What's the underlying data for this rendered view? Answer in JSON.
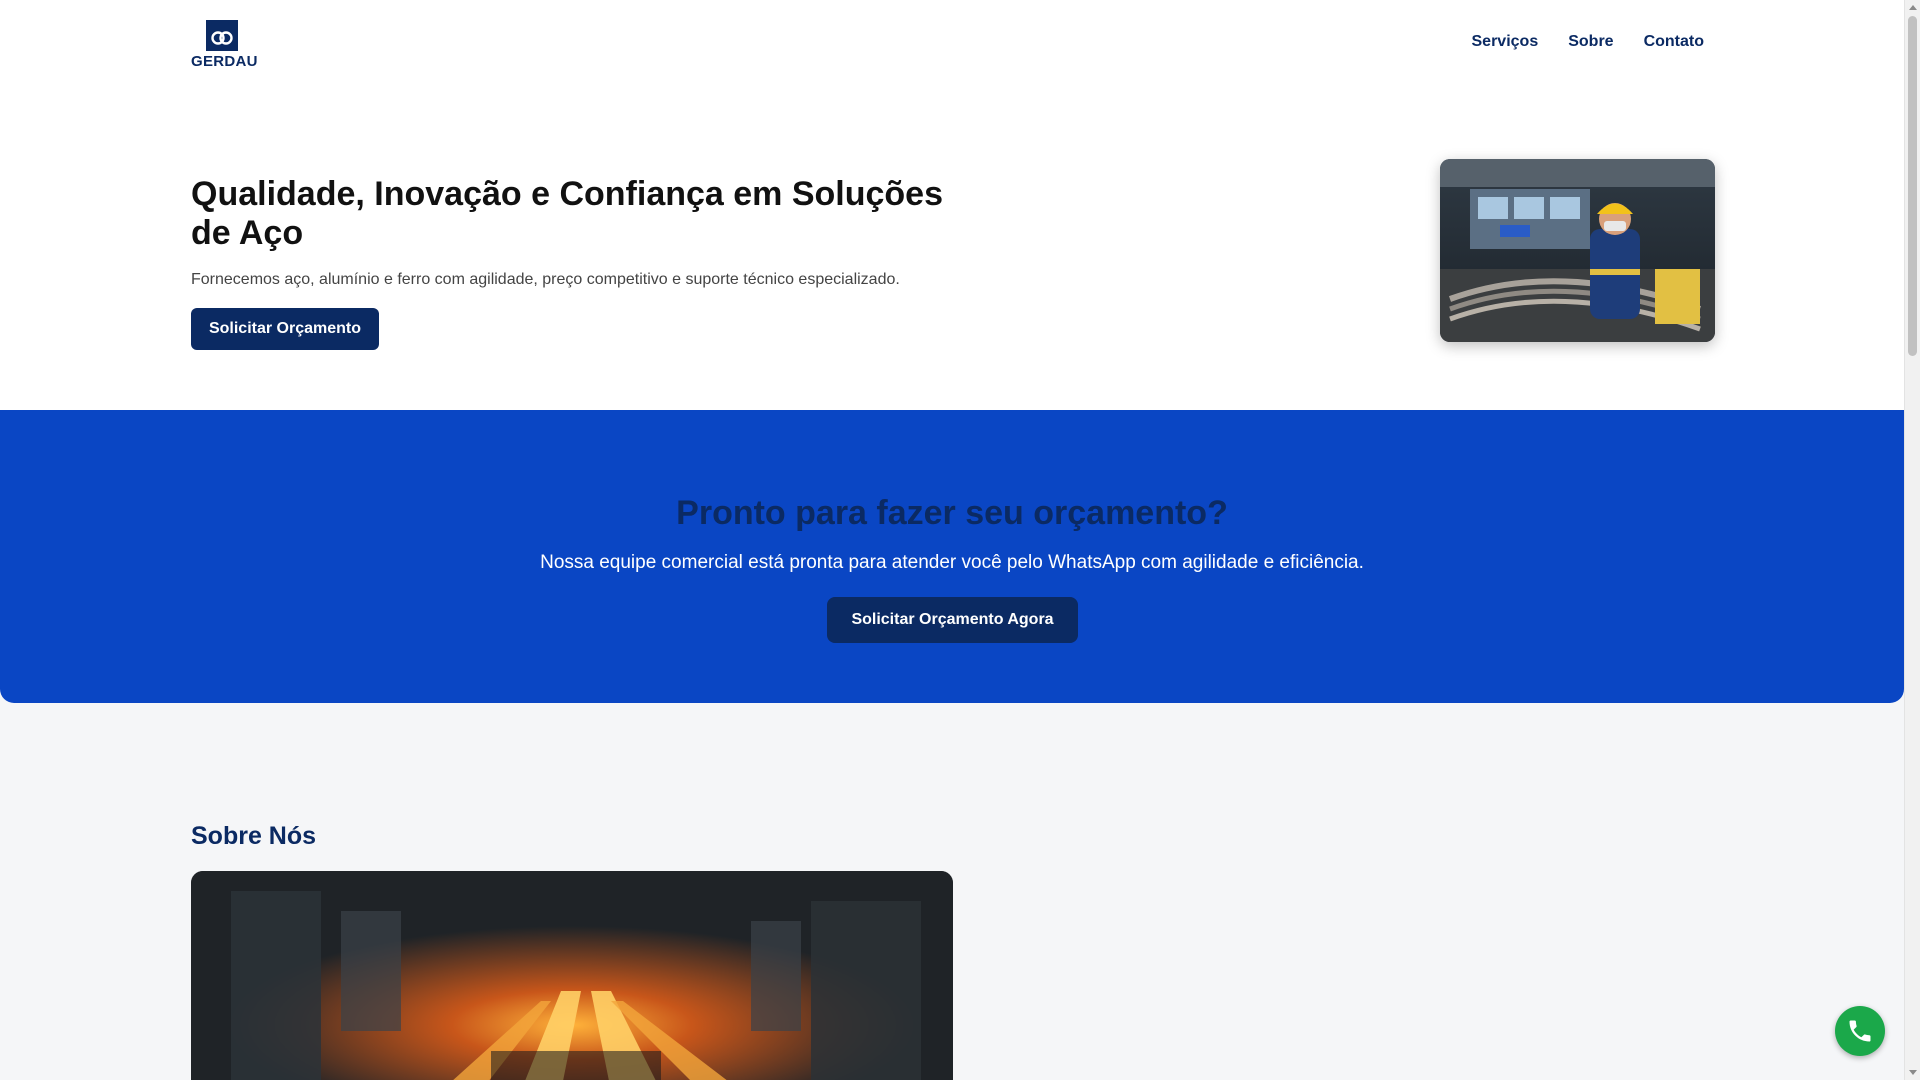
{
  "colors": {
    "brand_navy": "#0b2a63",
    "cta_blue": "#0a46c4",
    "page_bg": "#f5f6f8",
    "whatsapp_green": "#1ba84a"
  },
  "header": {
    "logo_text": "GERDAU",
    "nav": [
      {
        "label": "Serviços"
      },
      {
        "label": "Sobre"
      },
      {
        "label": "Contato"
      }
    ]
  },
  "hero": {
    "title": "Qualidade, Inovação e Confiança em Soluções de Aço",
    "subtitle": "Fornecemos aço, alumínio e ferro com agilidade, preço competitivo e suporte técnico especializado.",
    "button_label": "Solicitar Orçamento",
    "image_icon": "steel-worker-photo"
  },
  "cta": {
    "title": "Pronto para fazer seu orçamento?",
    "subtitle": "Nossa equipe comercial está pronta para atender você pelo WhatsApp com agilidade e eficiência.",
    "button_label": "Solicitar Orçamento Agora"
  },
  "about": {
    "title": "Sobre Nós",
    "image_icon": "steel-mill-photo"
  },
  "floating": {
    "phone_icon": "phone-icon"
  }
}
